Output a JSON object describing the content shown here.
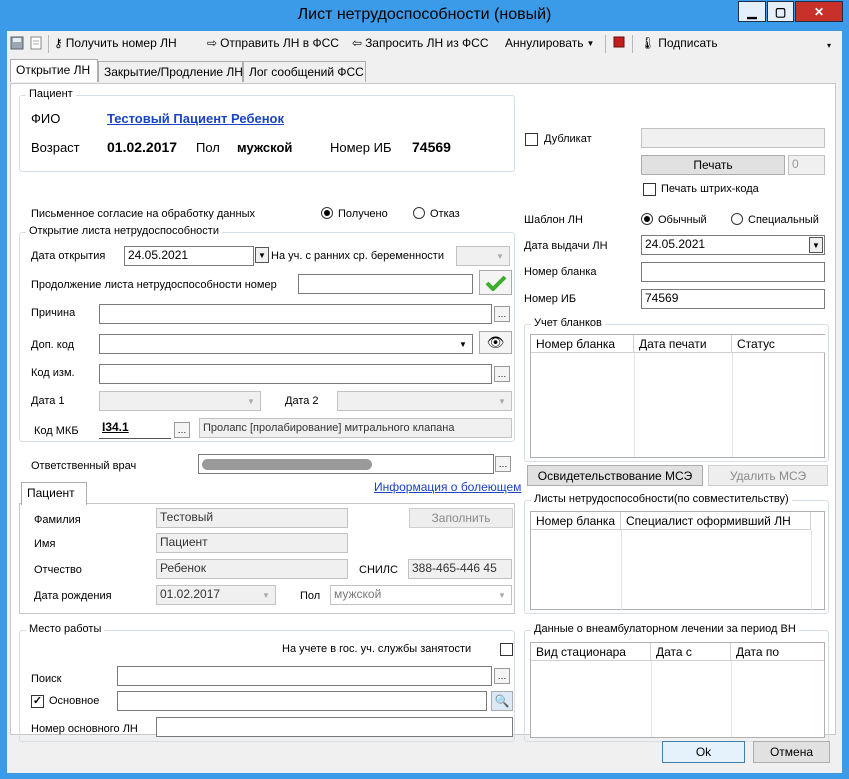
{
  "window": {
    "title": "Лист нетрудоспособности (новый)",
    "min": "▁",
    "max": "▢",
    "close": "✕"
  },
  "toolbar": {
    "get_number": "Получить номер ЛН",
    "send_fss": "Отправить ЛН в ФСС",
    "request_fss": "Запросить ЛН из ФСС",
    "annul": "Аннулировать",
    "sign": "Подписать"
  },
  "tabs": [
    "Открытие ЛН",
    "Закрытие/Продление ЛН",
    "Лог сообщений ФСС"
  ],
  "patient": {
    "group_title": "Пациент",
    "fio_label": "ФИО",
    "fio": "Тестовый Пациент Ребенок",
    "age_label": "Возраст",
    "dob": "01.02.2017",
    "sex_label": "Пол",
    "sex": "мужской",
    "ib_label": "Номер ИБ",
    "ib": "74569"
  },
  "consent": {
    "label": "Письменное согласие на обработку данных",
    "received": "Получено",
    "refused": "Отказ"
  },
  "opening": {
    "group_title": "Открытие листа нетрудоспособности",
    "date_label": "Дата открытия",
    "date": "24.05.2021",
    "pregnancy_label": "На уч. с ранних ср. беременности",
    "continuation_label": "Продолжение листа нетрудоспособности номер",
    "reason_label": "Причина",
    "add_code_label": "Доп. код",
    "change_code_label": "Код изм.",
    "date1_label": "Дата 1",
    "date2_label": "Дата 2",
    "mkb_label": "Код МКБ",
    "mkb_code": "I34.1",
    "mkb_text": "Пролапс [пролабирование] митрального клапана"
  },
  "doctor": {
    "label": "Ответственный врач"
  },
  "sick": {
    "tab": "Пациент",
    "info_link": "Информация о болеющем",
    "surname_label": "Фамилия",
    "surname": "Тестовый",
    "name_label": "Имя",
    "name": "Пациент",
    "patronymic_label": "Отчество",
    "patronymic": "Ребенок",
    "snils_label": "СНИЛС",
    "snils": "388-465-446 45",
    "fill_button": "Заполнить",
    "dob_label": "Дата рождения",
    "dob": "01.02.2017",
    "sex_label": "Пол",
    "sex": "мужской"
  },
  "work": {
    "group_title": "Место работы",
    "employment_label": "На учете в гос. уч. службы занятости",
    "search_label": "Поиск",
    "main_label": "Основное",
    "main_ln_label": "Номер основного ЛН"
  },
  "right": {
    "duplicate_label": "Дубликат",
    "print_button": "Печать",
    "print_count": "0",
    "barcode_label": "Печать штрих-кода",
    "template_label": "Шаблон ЛН",
    "template_normal": "Обычный",
    "template_special": "Специальный",
    "issue_date_label": "Дата выдачи ЛН",
    "issue_date": "24.05.2021",
    "blank_label": "Номер бланка",
    "ib_label": "Номер ИБ",
    "ib": "74569",
    "blanks_group": "Учет бланков",
    "blanks_cols": [
      "Номер бланка",
      "Дата печати",
      "Статус"
    ],
    "mse_button": "Освидетельствование МСЭ",
    "del_mse_button": "Удалить МСЭ",
    "parttime_group": "Листы нетрудоспособности(по совместительству)",
    "parttime_cols": [
      "Номер бланка",
      "Специалист оформивший ЛН"
    ],
    "outpatient_group": "Данные о внеамбулаторном лечении за период ВН",
    "outpatient_cols": [
      "Вид стационара",
      "Дата с",
      "Дата по"
    ]
  },
  "footer": {
    "ok": "Ok",
    "cancel": "Отмена"
  }
}
